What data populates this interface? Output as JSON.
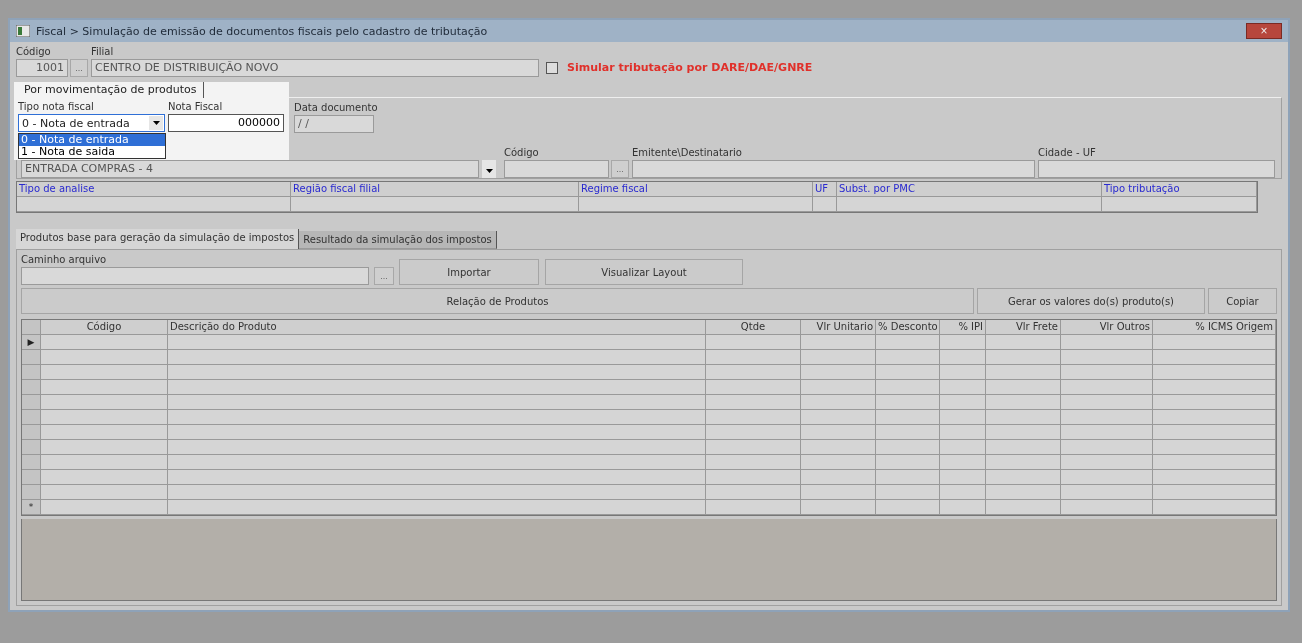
{
  "window": {
    "title": "Fiscal > Simulação de emissão de documentos fiscais pelo cadastro de tributação",
    "close": "×"
  },
  "header": {
    "codigo_label": "Código",
    "codigo_value": "1001",
    "browse_button": "...",
    "filial_label": "Filial",
    "filial_value": "CENTRO DE DISTRIBUIÇÃO NOVO",
    "simulate": {
      "label": "Simular tributação por DARE/DAE/GNRE",
      "checked": false
    }
  },
  "mode_tab": {
    "label": "Por movimentação de produtos",
    "selected": true
  },
  "tipo_nota": {
    "label": "Tipo nota fiscal",
    "value": "0 - Nota de entrada",
    "expanded": true,
    "options": [
      {
        "label": "0 - Nota de entrada",
        "selected": true
      },
      {
        "label": "1 - Nota de saida",
        "selected": false
      }
    ]
  },
  "nota_fiscal": {
    "label": "Nota Fiscal",
    "value": "000000"
  },
  "data_documento": {
    "label": "Data documento",
    "value": "/ /"
  },
  "operation": {
    "value": "ENTRADA COMPRAS - 4"
  },
  "codigo2": {
    "label": "Código",
    "browse_button": "..."
  },
  "emitente": {
    "label": "Emitente\\Destinatario"
  },
  "cidade": {
    "label": "Cidade - UF"
  },
  "analysis_table": {
    "columns": [
      "Tipo de analise",
      "Região fiscal filial",
      "Regime fiscal",
      "UF",
      "Subst. por PMC",
      "Tipo tributação"
    ]
  },
  "tabs": [
    {
      "label": "Produtos base para geração da simulação de impostos",
      "selected": true
    },
    {
      "label": "Resultado da simulação dos impostos",
      "selected": false
    }
  ],
  "caminho": {
    "label": "Caminho arquivo",
    "browse_button": "..."
  },
  "buttons": {
    "importar": "Importar",
    "layout": "Visualizar Layout",
    "relacao": "Relação de Produtos",
    "gerar": "Gerar os valores do(s) produto(s)",
    "copiar": "Copiar"
  },
  "products_table": {
    "columns": [
      "Código",
      "Descrição do Produto",
      "Qtde",
      "Vlr Unitario",
      "% Desconto",
      "% IPI",
      "Vlr Frete",
      "Vlr Outros",
      "% ICMS Origem"
    ],
    "rows": [
      {
        "kind": "current",
        "marker": "▶"
      },
      {
        "kind": "empty"
      },
      {
        "kind": "empty"
      },
      {
        "kind": "empty"
      },
      {
        "kind": "empty"
      },
      {
        "kind": "empty"
      },
      {
        "kind": "empty"
      },
      {
        "kind": "empty"
      },
      {
        "kind": "empty"
      },
      {
        "kind": "empty"
      },
      {
        "kind": "empty"
      },
      {
        "kind": "new",
        "marker": "*"
      }
    ]
  }
}
